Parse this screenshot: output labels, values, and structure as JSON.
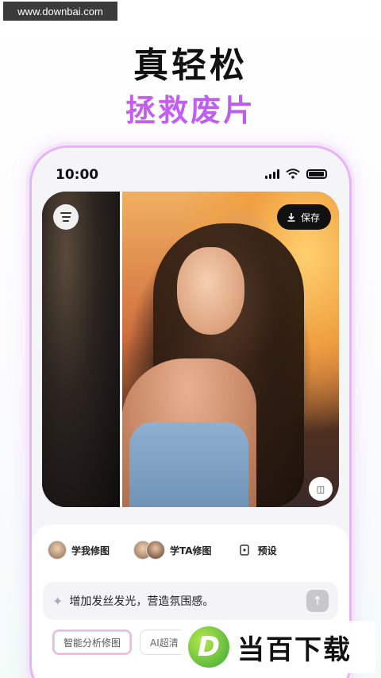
{
  "watermark": {
    "site": "www.downbai.com"
  },
  "headline": {
    "line1": "真轻松",
    "line2": "拯救废片"
  },
  "status_bar": {
    "time": "10:00"
  },
  "editor": {
    "save_label": "保存",
    "compare_label": "◫"
  },
  "modes": [
    {
      "label": "学我修图",
      "icon": "avatar"
    },
    {
      "label": "学TA修图",
      "icon": "avatar-pair"
    },
    {
      "label": "预设",
      "icon": "preset-icon"
    }
  ],
  "prompt": {
    "text": "增加发丝发光，营造氛围感。"
  },
  "chips": [
    {
      "label": "智能分析修图",
      "active": true
    },
    {
      "label": "AI超清",
      "active": false
    }
  ],
  "brand": {
    "logo_letter": "D",
    "name": "当百下载"
  },
  "colors": {
    "accent_purple": "#c95cf0",
    "phone_border": "#e6b4f7"
  }
}
